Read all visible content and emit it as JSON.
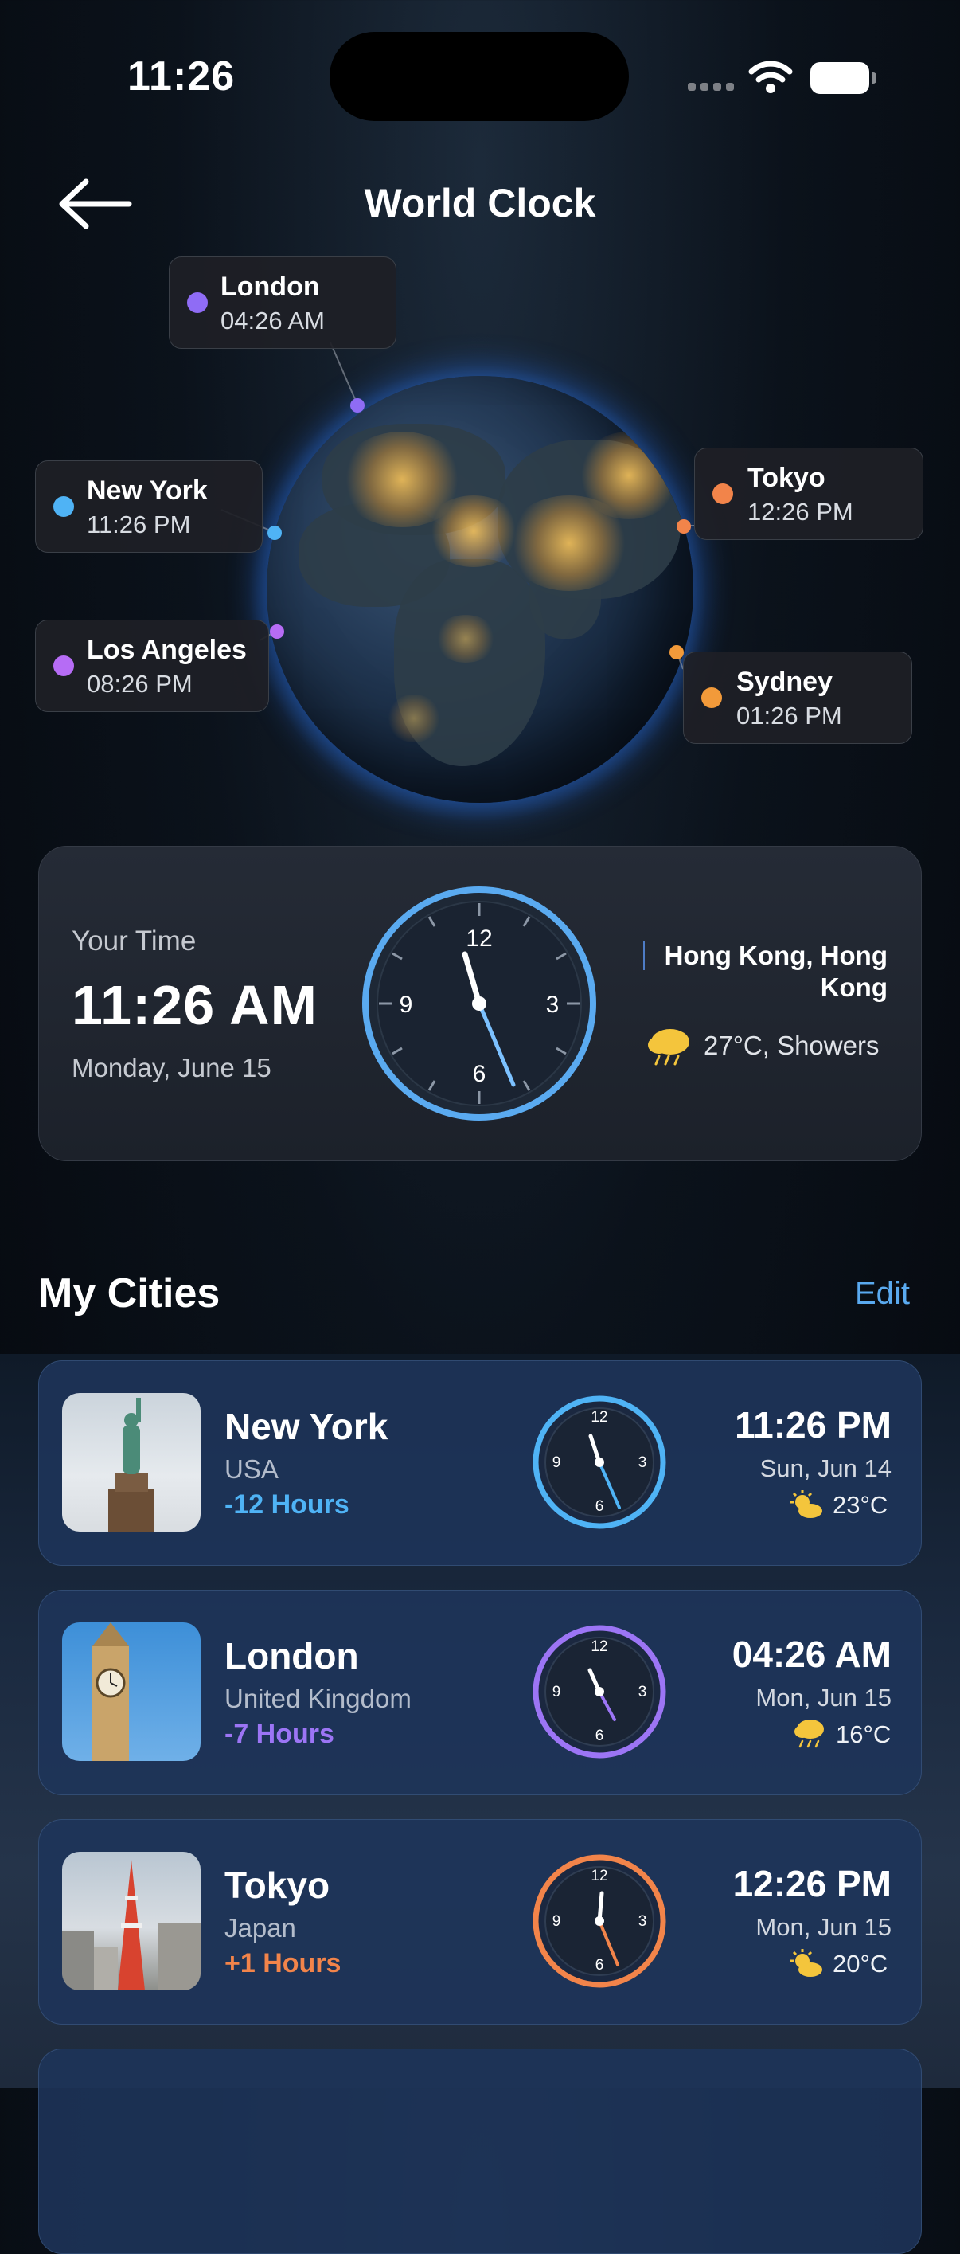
{
  "status_bar": {
    "time": "11:26"
  },
  "header": {
    "title": "World Clock"
  },
  "globe_tags": [
    {
      "name": "London",
      "time": "04:26 AM",
      "color": "#8f6cf5"
    },
    {
      "name": "New York",
      "time": "11:26 PM",
      "color": "#4fb3f5"
    },
    {
      "name": "Los Angeles",
      "time": "08:26 PM",
      "color": "#b66cf5"
    },
    {
      "name": "Tokyo",
      "time": "12:26 PM",
      "color": "#f2844a"
    },
    {
      "name": "Sydney",
      "time": "01:26 PM",
      "color": "#f29a3a"
    }
  ],
  "your_time": {
    "label": "Your Time",
    "time": "11:26 AM",
    "date": "Monday, June 15",
    "location_line1": "Hong Kong, Hong",
    "location_line2": "Kong",
    "weather": "27°C, Showers",
    "dial_numbers": [
      "12",
      "3",
      "6",
      "9"
    ],
    "accent": "#5aaaf0"
  },
  "my_cities": {
    "title": "My Cities",
    "edit_label": "Edit",
    "cities": [
      {
        "name": "New York",
        "country": "USA",
        "offset": "-12 Hours",
        "time": "11:26 PM",
        "date": "Sun, Jun 14",
        "temp": "23°C",
        "accent": "#4fb3f5",
        "dial_numbers": [
          "12",
          "3",
          "6",
          "9"
        ]
      },
      {
        "name": "London",
        "country": "United Kingdom",
        "offset": "-7 Hours",
        "time": "04:26 AM",
        "date": "Mon, Jun 15",
        "temp": "16°C",
        "accent": "#9c75f5",
        "dial_numbers": [
          "12",
          "3",
          "6",
          "9"
        ]
      },
      {
        "name": "Tokyo",
        "country": "Japan",
        "offset": "+1 Hours",
        "time": "12:26 PM",
        "date": "Mon, Jun 15",
        "temp": "20°C",
        "accent": "#f2844a",
        "dial_numbers": [
          "12",
          "3",
          "6",
          "9"
        ]
      }
    ]
  }
}
